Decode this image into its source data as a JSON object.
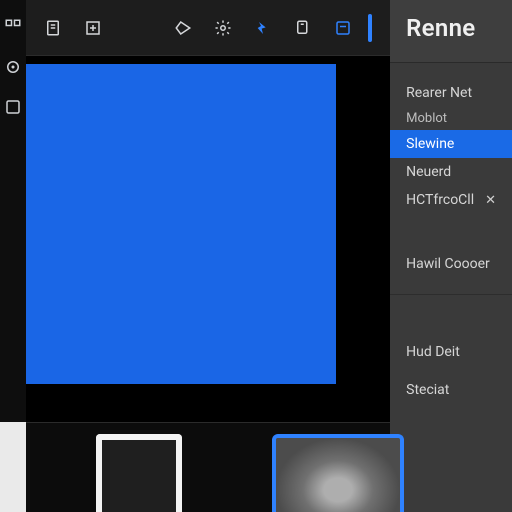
{
  "toolbar": {
    "icons": {
      "files": "files-icon",
      "export": "export-icon",
      "panel": "panel-icon",
      "tag": "tag-icon",
      "gear": "gear-icon",
      "fx": "fx-icon",
      "layers": "layers-icon",
      "render": "render-indicator"
    }
  },
  "leftbar": {
    "icons": {
      "home": "home-icon",
      "cursor": "cursor-icon",
      "edit": "edit-icon"
    }
  },
  "side_panel": {
    "title": "Renne",
    "groups": [
      {
        "items": [
          {
            "label": "Rearer Net",
            "selected": false
          },
          {
            "label": "Moblot",
            "selected": false,
            "sub": true
          },
          {
            "label": "Slewine",
            "selected": true
          },
          {
            "label": "Neuerd",
            "selected": false
          },
          {
            "label": "HCTfrcoCll",
            "selected": false,
            "closable": true
          }
        ]
      },
      {
        "items": [
          {
            "label": "Hawil Coooer",
            "selected": false
          }
        ]
      },
      {
        "items": [
          {
            "label": "Hud Deit",
            "selected": false
          },
          {
            "label": "Steciat",
            "selected": false
          }
        ]
      }
    ]
  },
  "thumbnails": {
    "count": 2,
    "selected_index": 1
  },
  "colors": {
    "accent": "#1a66e6",
    "panel": "#3a3a3a"
  }
}
